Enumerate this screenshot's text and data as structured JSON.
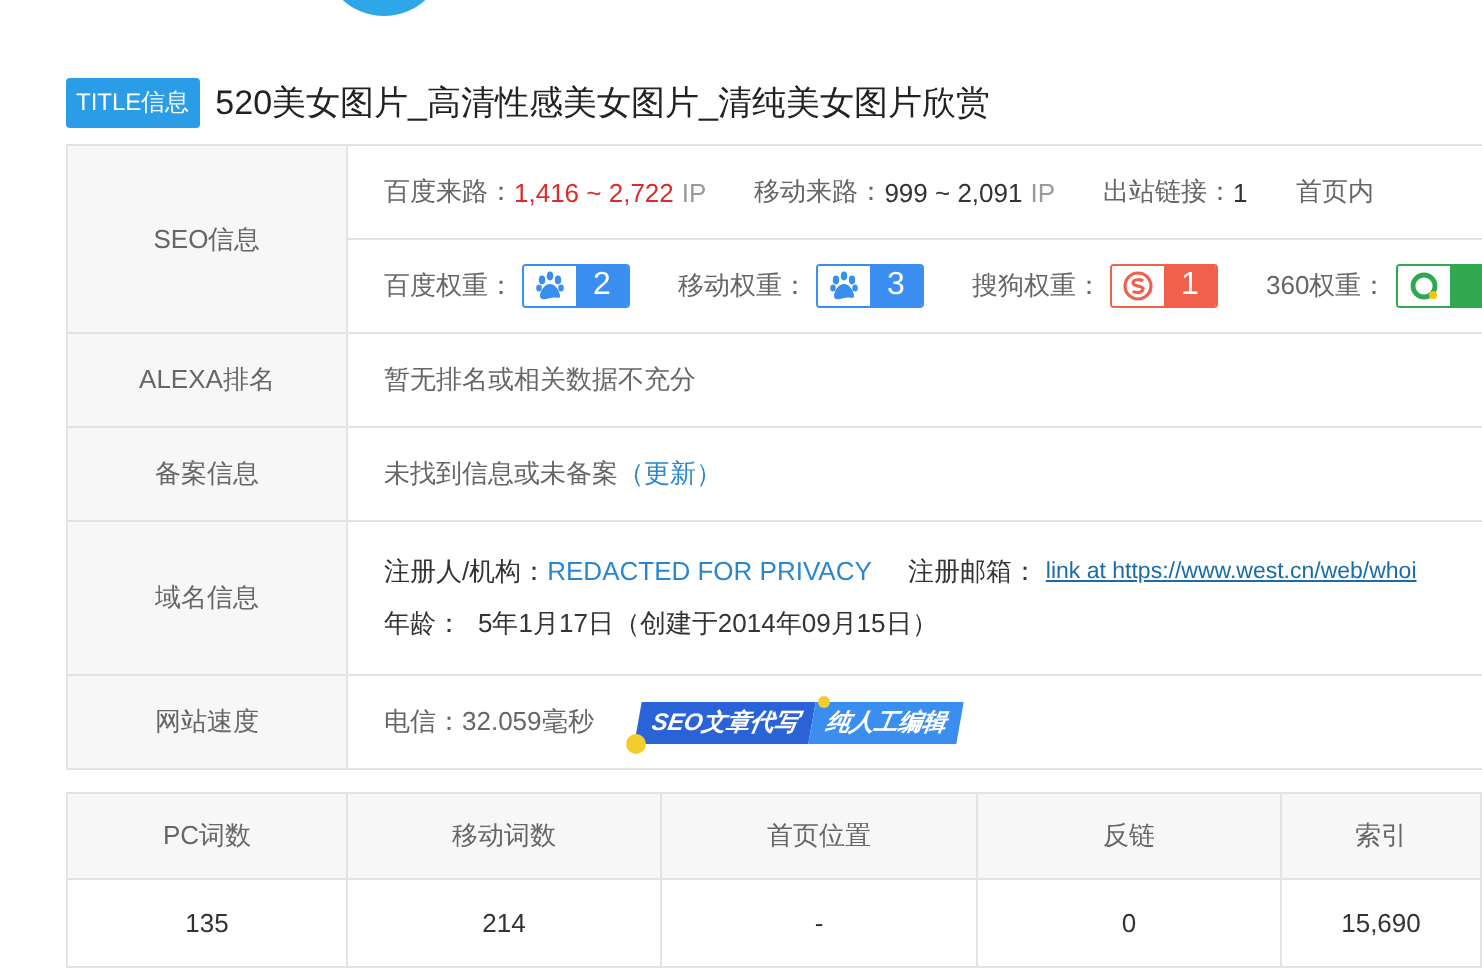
{
  "title": {
    "badge": "TITLE信息",
    "text": "520美女图片_高清性感美女图片_清纯美女图片欣赏"
  },
  "info_table": {
    "seo": {
      "label": "SEO信息",
      "traffic": [
        {
          "label": "百度来路：",
          "value": "1,416 ~ 2,722",
          "unit": "IP",
          "highlight": true
        },
        {
          "label": "移动来路：",
          "value": "999 ~ 2,091",
          "unit": "IP",
          "highlight": false
        },
        {
          "label": "出站链接：",
          "value": "1",
          "highlight": false
        },
        {
          "label": "首页内"
        }
      ],
      "weights": [
        {
          "label": "百度权重：",
          "kind": "baidu",
          "value": "2",
          "color": "#3a8ef0"
        },
        {
          "label": "移动权重：",
          "kind": "mobile",
          "value": "3",
          "color": "#3a8ef0"
        },
        {
          "label": "搜狗权重：",
          "kind": "sogou",
          "value": "1",
          "color": "#f0604a"
        },
        {
          "label": "360权重：",
          "kind": "qihoo",
          "color": "#2fa84f"
        }
      ]
    },
    "alexa": {
      "label": "ALEXA排名",
      "text": "暂无排名或相关数据不充分"
    },
    "icp": {
      "label": "备案信息",
      "text": "未找到信息或未备案",
      "link": "（更新）"
    },
    "domain": {
      "label": "域名信息",
      "registrant_label": "注册人/机构：",
      "registrant": "REDACTED FOR PRIVACY",
      "email_label": "注册邮箱：",
      "email": "link at https://www.west.cn/web/whoi",
      "age_label": "年龄：",
      "age": "5年1月17日",
      "created": "（创建于2014年09月15日）"
    },
    "speed": {
      "label": "网站速度",
      "text": "电信：32.059毫秒",
      "ad": [
        "SEO文章代写",
        "纯人工编辑"
      ]
    }
  },
  "stats_table": {
    "columns": [
      "PC词数",
      "移动词数",
      "首页位置",
      "反链",
      "索引"
    ],
    "rows": [
      [
        "135",
        "214",
        "-",
        "0",
        "15,690"
      ]
    ]
  }
}
